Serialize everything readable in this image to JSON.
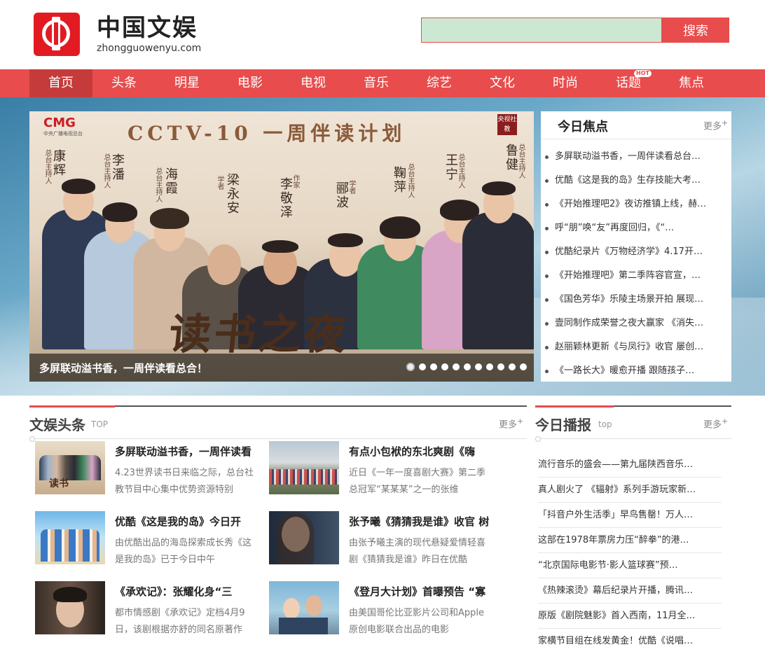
{
  "logo": {
    "name_cn": "中国文娱",
    "domain": "zhongguowenyu.com"
  },
  "search": {
    "placeholder": "",
    "button_label": "搜索"
  },
  "nav": {
    "items": [
      "首页",
      "头条",
      "明星",
      "电影",
      "电视",
      "音乐",
      "综艺",
      "文化",
      "时尚",
      "话题",
      "焦点"
    ],
    "active_index": 0,
    "hot_badge": "HOT"
  },
  "slider": {
    "caption": "多屏联动溢书香，一周伴读看总合！",
    "slide_count": 11,
    "current_index": 0,
    "image": {
      "logo": "CMG",
      "logo_sub": "中央广播电视总台",
      "title": "CCTV-10 一周伴读计划",
      "badge": "央视社教",
      "big_text": "读书之夜",
      "people": [
        {
          "name": "康辉",
          "role": "总台主持人"
        },
        {
          "name": "李潘",
          "role": "总台主持人"
        },
        {
          "name": "海霞",
          "role": "总台主持人"
        },
        {
          "name": "梁永安",
          "role": "学者"
        },
        {
          "name": "李敬泽",
          "role": "作家"
        },
        {
          "name": "郦波",
          "role": "学者"
        },
        {
          "name": "鞠萍",
          "role": "总台主持人"
        },
        {
          "name": "王宁",
          "role": "总台主持人"
        },
        {
          "name": "鲁健",
          "role": "总台主持人"
        }
      ]
    }
  },
  "focus": {
    "title": "今日焦点",
    "more": "更多",
    "items": [
      "多屏联动溢书香，一周伴读看总台…",
      "优酷《这是我的岛》生存技能大考…",
      "《开始推理吧2》夜访推镇上线，赫…",
      "呼“朋”唤“友”再度回归，《“…",
      "优酷纪录片《万物经济学》4.17开…",
      "《开始推理吧》第二季阵容官宣，…",
      "《国色芳华》乐陵主场景开拍 展现…",
      "壹同制作成荣誉之夜大赢家 《消失…",
      "赵丽颖林更新《与凤行》收官 屡创…",
      "《一路长大》暖愈开播 跟随孩子…"
    ]
  },
  "headlines": {
    "title": "文娱头条",
    "tag": "TOP",
    "more": "更多",
    "items": [
      {
        "title": "多屏联动溢书香，一周伴读看",
        "desc": "4.23世界读书日来临之际，总台社教节目中心集中优势资源特别"
      },
      {
        "title": "有点小包袱的东北爽剧《嗨",
        "desc": "近日《一年一度喜剧大赛》第二季总冠军“某某某”之一的张维"
      },
      {
        "title": "优酷《这是我的岛》今日开",
        "desc": "由优酷出品的海岛探索成长秀《这是我的岛》已于今日中午"
      },
      {
        "title": "张予曦《猜猜我是谁》收官 树",
        "desc": "由张予曦主演的现代悬疑爱情轻喜剧《猜猜我是谁》昨日在优酷"
      },
      {
        "title": "《承欢记》：张耀化身“三",
        "desc": "都市情感剧《承欢记》定档4月9日，该剧根据亦舒的同名原著作"
      },
      {
        "title": "《登月大计划》首曝预告 “寡",
        "desc": "由美国哥伦比亚影片公司和Apple原创电影联合出品的电影"
      }
    ]
  },
  "broadcast": {
    "title": "今日播报",
    "tag": "top",
    "more": "更多",
    "items": [
      "流行音乐的盛会——第九届陕西音乐…",
      "真人剧火了 《辐射》系列手游玩家新…",
      "「抖音户外生活季」早鸟售罄！万人…",
      "这部在1978年票房力压“醉拳”的港…",
      "“北京国际电影节·影人篮球赛”预…",
      "《热辣滚烫》幕后纪录片开播，腾讯…",
      "原版《剧院魅影》首入西南，11月全…",
      "家横节目组在线发黄金！优酷《说唱…"
    ]
  },
  "colors": {
    "accent": "#e84c4c",
    "search_field": "#cde8d2"
  }
}
